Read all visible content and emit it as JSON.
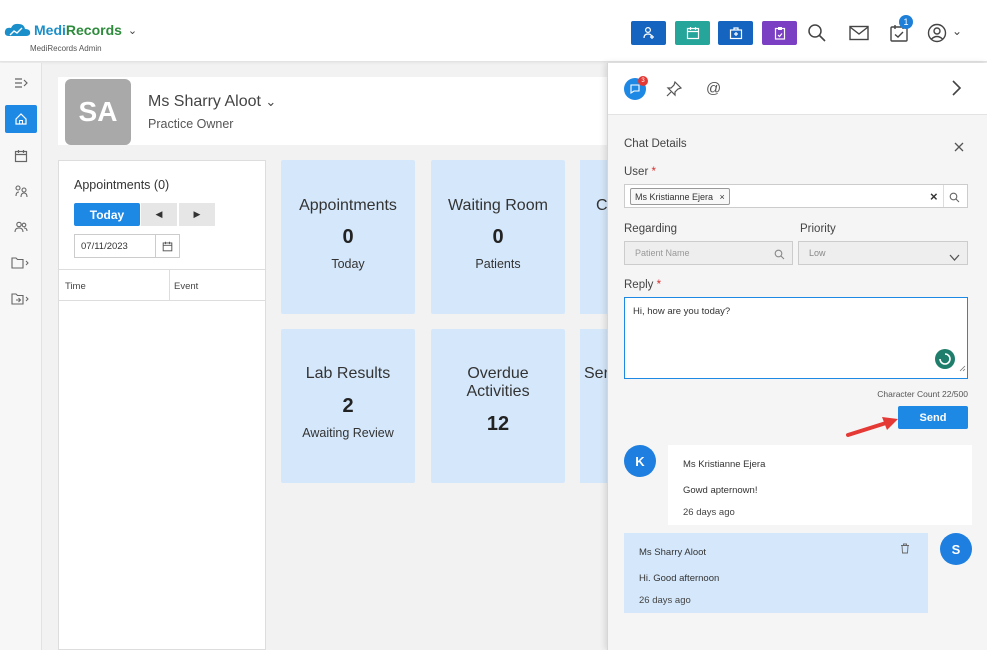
{
  "app": {
    "name_part1": "Medi",
    "name_part2": "Records",
    "subtitle": "MediRecords Admin"
  },
  "header": {
    "tasks_badge": "1"
  },
  "profile": {
    "initials": "SA",
    "name": "Ms Sharry Aloot",
    "role": "Practice Owner"
  },
  "appointments": {
    "title": "Appointments (0)",
    "today_label": "Today",
    "prev_label": "◀",
    "next_label": "▶",
    "date": "07/11/2023",
    "col_time": "Time",
    "col_event": "Event"
  },
  "tiles": [
    {
      "title": "Appointments",
      "value": "0",
      "sub": "Today"
    },
    {
      "title": "Waiting Room",
      "value": "0",
      "sub": "Patients"
    },
    {
      "title": "C",
      "value": "",
      "sub": ""
    },
    {
      "title": "Lab Results",
      "value": "2",
      "sub": "Awaiting Review"
    },
    {
      "title": "Overdue\nActivities",
      "title_line1": "Overdue",
      "title_line2": "Activities",
      "value": "12",
      "sub": ""
    },
    {
      "title": "Ser",
      "value": "",
      "sub": ""
    }
  ],
  "chat": {
    "chat_badge": "3",
    "details_title": "Chat Details",
    "user_label": "User",
    "required_mark": "*",
    "user_chip": "Ms Kristianne Ejera",
    "chip_remove": "×",
    "regarding_label": "Regarding",
    "regarding_placeholder": "Patient Name",
    "priority_label": "Priority",
    "priority_value": "Low",
    "reply_label": "Reply",
    "reply_text": "Hi, how are you today?",
    "char_count": "Character Count 22/500",
    "send_label": "Send",
    "messages": [
      {
        "initial": "K",
        "author": "Ms Kristianne Ejera",
        "text": "Gowd apternown!",
        "time": "26 days ago"
      },
      {
        "initial": "S",
        "author": "Ms Sharry Aloot",
        "text": "Hi. Good afternoon",
        "time": "26 days ago"
      }
    ]
  },
  "colors": {
    "primary": "#1e88e5",
    "teal": "#26a69a",
    "purple": "#7b3fc4",
    "navy": "#1565c0",
    "tile": "#d5e8fb"
  }
}
